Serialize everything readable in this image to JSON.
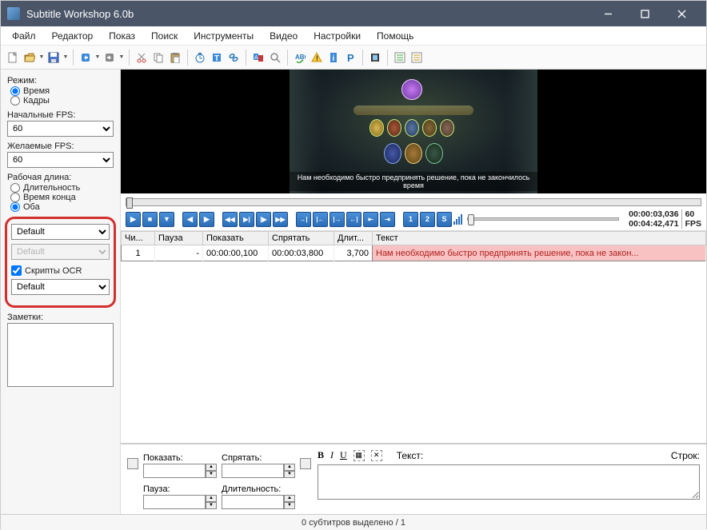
{
  "window": {
    "title": "Subtitle Workshop 6.0b"
  },
  "menu": [
    "Файл",
    "Редактор",
    "Показ",
    "Поиск",
    "Инструменты",
    "Видео",
    "Настройки",
    "Помощь"
  ],
  "sidebar": {
    "mode_label": "Режим:",
    "mode_time": "Время",
    "mode_frames": "Кадры",
    "start_fps_label": "Начальные FPS:",
    "start_fps": "60",
    "want_fps_label": "Желаемые FPS:",
    "want_fps": "60",
    "worklen_label": "Рабочая длина:",
    "wl_dur": "Длительность",
    "wl_end": "Время конца",
    "wl_both": "Оба",
    "default1": "Default",
    "default2": "Default",
    "ocr_label": "Скрипты OCR",
    "default3": "Default",
    "notes_label": "Заметки:"
  },
  "video": {
    "caption": "Нам необходимо быстро предпринять решение, пока не закончилось время"
  },
  "time": {
    "pos": "00:00:03,036",
    "dur": "00:04:42,471",
    "fps1": "60",
    "fps2": "FPS"
  },
  "table": {
    "cols": [
      "Чи...",
      "Пауза",
      "Показать",
      "Спрятать",
      "Длит...",
      "Текст"
    ],
    "rows": [
      {
        "n": "1",
        "pause": "-",
        "show": "00:00:00,100",
        "hide": "00:00:03,800",
        "dur": "3,700",
        "text": "Нам необходимо быстро предпринять решение, пока не закон..."
      }
    ]
  },
  "editor": {
    "show": "Показать:",
    "hide": "Спрятать:",
    "pause": "Пауза:",
    "dur": "Длительность:",
    "text_label": "Текст:",
    "lines_label": "Строк:"
  },
  "status": "0 субтитров выделено / 1"
}
